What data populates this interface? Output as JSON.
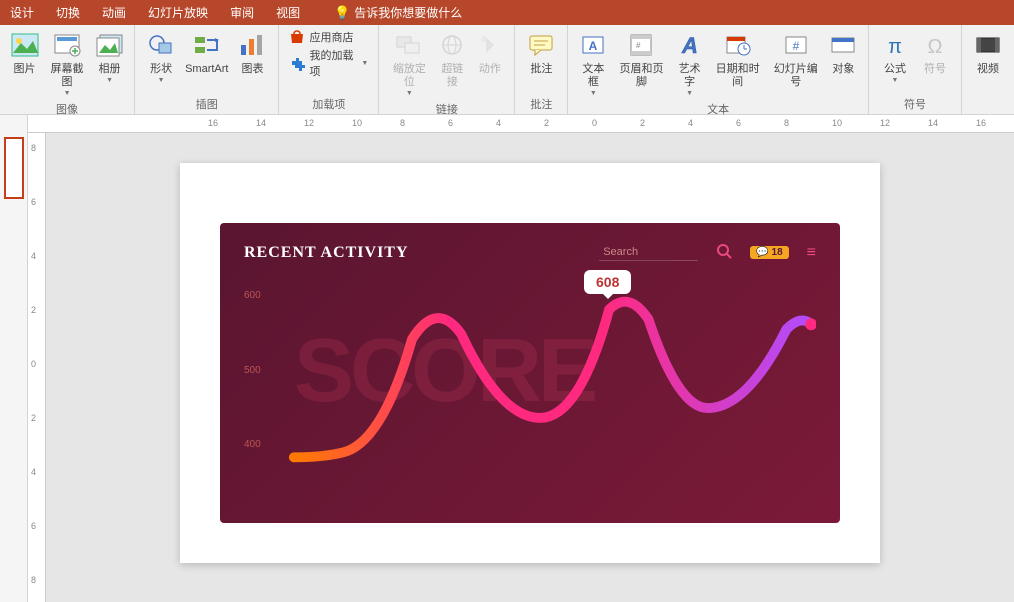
{
  "tabs": {
    "design": "设计",
    "transitions": "切换",
    "animations": "动画",
    "slideshow": "幻灯片放映",
    "review": "审阅",
    "view": "视图",
    "tell_me": "告诉我你想要做什么"
  },
  "ribbon": {
    "images": {
      "pictures": "图片",
      "screenshot": "屏幕截图",
      "album": "相册",
      "group_label": "图像"
    },
    "illustrations": {
      "shapes": "形状",
      "smartart": "SmartArt",
      "chart": "图表",
      "group_label": "插图"
    },
    "addins": {
      "store": "应用商店",
      "my_addins": "我的加载项",
      "group_label": "加载项"
    },
    "links": {
      "zoom": "缩放定位",
      "hyperlink": "超链接",
      "action": "动作",
      "group_label": "链接"
    },
    "comments": {
      "comment": "批注",
      "group_label": "批注"
    },
    "text": {
      "textbox": "文本框",
      "header_footer": "页眉和页脚",
      "wordart": "艺术字",
      "date_time": "日期和时间",
      "slide_number": "幻灯片编号",
      "object": "对象",
      "group_label": "文本"
    },
    "symbols": {
      "equation": "公式",
      "symbol": "符号",
      "group_label": "符号"
    },
    "media": {
      "video": "视频"
    }
  },
  "ruler": {
    "h_ticks": [
      "16",
      "14",
      "12",
      "10",
      "8",
      "6",
      "4",
      "2",
      "0",
      "2",
      "4",
      "6",
      "8",
      "10",
      "12",
      "14",
      "16"
    ],
    "v_ticks": [
      "8",
      "6",
      "4",
      "2",
      "0",
      "2",
      "4",
      "6",
      "8"
    ]
  },
  "dashboard": {
    "title": "RECENT ACTIVITY",
    "search_placeholder": "Search",
    "notification_count": "18",
    "tooltip_value": "608",
    "background_text": "SCORE",
    "y_axis": [
      "600",
      "500",
      "400"
    ]
  },
  "chart_data": {
    "type": "line",
    "title": "RECENT ACTIVITY",
    "ylabel": "",
    "xlabel": "",
    "ylim": [
      400,
      650
    ],
    "y_ticks": [
      400,
      500,
      600
    ],
    "highlighted_value": 608,
    "values": [
      400,
      410,
      420,
      560,
      570,
      470,
      460,
      608,
      500,
      460,
      500,
      580
    ]
  }
}
